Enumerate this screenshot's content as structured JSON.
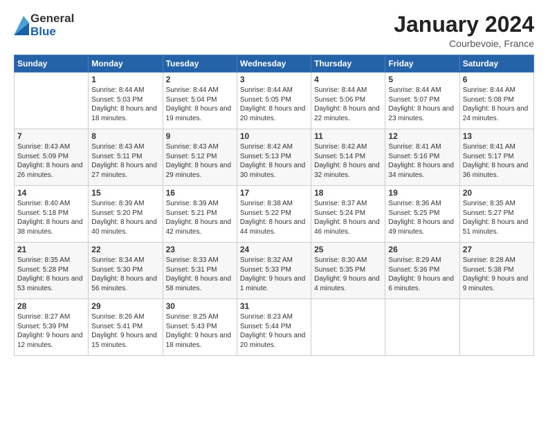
{
  "logo": {
    "general": "General",
    "blue": "Blue"
  },
  "title": "January 2024",
  "location": "Courbevoie, France",
  "days_of_week": [
    "Sunday",
    "Monday",
    "Tuesday",
    "Wednesday",
    "Thursday",
    "Friday",
    "Saturday"
  ],
  "weeks": [
    [
      {
        "day": "",
        "sunrise": "",
        "sunset": "",
        "daylight": ""
      },
      {
        "day": "1",
        "sunrise": "Sunrise: 8:44 AM",
        "sunset": "Sunset: 5:03 PM",
        "daylight": "Daylight: 8 hours and 18 minutes."
      },
      {
        "day": "2",
        "sunrise": "Sunrise: 8:44 AM",
        "sunset": "Sunset: 5:04 PM",
        "daylight": "Daylight: 8 hours and 19 minutes."
      },
      {
        "day": "3",
        "sunrise": "Sunrise: 8:44 AM",
        "sunset": "Sunset: 5:05 PM",
        "daylight": "Daylight: 8 hours and 20 minutes."
      },
      {
        "day": "4",
        "sunrise": "Sunrise: 8:44 AM",
        "sunset": "Sunset: 5:06 PM",
        "daylight": "Daylight: 8 hours and 22 minutes."
      },
      {
        "day": "5",
        "sunrise": "Sunrise: 8:44 AM",
        "sunset": "Sunset: 5:07 PM",
        "daylight": "Daylight: 8 hours and 23 minutes."
      },
      {
        "day": "6",
        "sunrise": "Sunrise: 8:44 AM",
        "sunset": "Sunset: 5:08 PM",
        "daylight": "Daylight: 8 hours and 24 minutes."
      }
    ],
    [
      {
        "day": "7",
        "sunrise": "Sunrise: 8:43 AM",
        "sunset": "Sunset: 5:09 PM",
        "daylight": "Daylight: 8 hours and 26 minutes."
      },
      {
        "day": "8",
        "sunrise": "Sunrise: 8:43 AM",
        "sunset": "Sunset: 5:11 PM",
        "daylight": "Daylight: 8 hours and 27 minutes."
      },
      {
        "day": "9",
        "sunrise": "Sunrise: 8:43 AM",
        "sunset": "Sunset: 5:12 PM",
        "daylight": "Daylight: 8 hours and 29 minutes."
      },
      {
        "day": "10",
        "sunrise": "Sunrise: 8:42 AM",
        "sunset": "Sunset: 5:13 PM",
        "daylight": "Daylight: 8 hours and 30 minutes."
      },
      {
        "day": "11",
        "sunrise": "Sunrise: 8:42 AM",
        "sunset": "Sunset: 5:14 PM",
        "daylight": "Daylight: 8 hours and 32 minutes."
      },
      {
        "day": "12",
        "sunrise": "Sunrise: 8:41 AM",
        "sunset": "Sunset: 5:16 PM",
        "daylight": "Daylight: 8 hours and 34 minutes."
      },
      {
        "day": "13",
        "sunrise": "Sunrise: 8:41 AM",
        "sunset": "Sunset: 5:17 PM",
        "daylight": "Daylight: 8 hours and 36 minutes."
      }
    ],
    [
      {
        "day": "14",
        "sunrise": "Sunrise: 8:40 AM",
        "sunset": "Sunset: 5:18 PM",
        "daylight": "Daylight: 8 hours and 38 minutes."
      },
      {
        "day": "15",
        "sunrise": "Sunrise: 8:39 AM",
        "sunset": "Sunset: 5:20 PM",
        "daylight": "Daylight: 8 hours and 40 minutes."
      },
      {
        "day": "16",
        "sunrise": "Sunrise: 8:39 AM",
        "sunset": "Sunset: 5:21 PM",
        "daylight": "Daylight: 8 hours and 42 minutes."
      },
      {
        "day": "17",
        "sunrise": "Sunrise: 8:38 AM",
        "sunset": "Sunset: 5:22 PM",
        "daylight": "Daylight: 8 hours and 44 minutes."
      },
      {
        "day": "18",
        "sunrise": "Sunrise: 8:37 AM",
        "sunset": "Sunset: 5:24 PM",
        "daylight": "Daylight: 8 hours and 46 minutes."
      },
      {
        "day": "19",
        "sunrise": "Sunrise: 8:36 AM",
        "sunset": "Sunset: 5:25 PM",
        "daylight": "Daylight: 8 hours and 49 minutes."
      },
      {
        "day": "20",
        "sunrise": "Sunrise: 8:35 AM",
        "sunset": "Sunset: 5:27 PM",
        "daylight": "Daylight: 8 hours and 51 minutes."
      }
    ],
    [
      {
        "day": "21",
        "sunrise": "Sunrise: 8:35 AM",
        "sunset": "Sunset: 5:28 PM",
        "daylight": "Daylight: 8 hours and 53 minutes."
      },
      {
        "day": "22",
        "sunrise": "Sunrise: 8:34 AM",
        "sunset": "Sunset: 5:30 PM",
        "daylight": "Daylight: 8 hours and 56 minutes."
      },
      {
        "day": "23",
        "sunrise": "Sunrise: 8:33 AM",
        "sunset": "Sunset: 5:31 PM",
        "daylight": "Daylight: 8 hours and 58 minutes."
      },
      {
        "day": "24",
        "sunrise": "Sunrise: 8:32 AM",
        "sunset": "Sunset: 5:33 PM",
        "daylight": "Daylight: 9 hours and 1 minute."
      },
      {
        "day": "25",
        "sunrise": "Sunrise: 8:30 AM",
        "sunset": "Sunset: 5:35 PM",
        "daylight": "Daylight: 9 hours and 4 minutes."
      },
      {
        "day": "26",
        "sunrise": "Sunrise: 8:29 AM",
        "sunset": "Sunset: 5:36 PM",
        "daylight": "Daylight: 9 hours and 6 minutes."
      },
      {
        "day": "27",
        "sunrise": "Sunrise: 8:28 AM",
        "sunset": "Sunset: 5:38 PM",
        "daylight": "Daylight: 9 hours and 9 minutes."
      }
    ],
    [
      {
        "day": "28",
        "sunrise": "Sunrise: 8:27 AM",
        "sunset": "Sunset: 5:39 PM",
        "daylight": "Daylight: 9 hours and 12 minutes."
      },
      {
        "day": "29",
        "sunrise": "Sunrise: 8:26 AM",
        "sunset": "Sunset: 5:41 PM",
        "daylight": "Daylight: 9 hours and 15 minutes."
      },
      {
        "day": "30",
        "sunrise": "Sunrise: 8:25 AM",
        "sunset": "Sunset: 5:43 PM",
        "daylight": "Daylight: 9 hours and 18 minutes."
      },
      {
        "day": "31",
        "sunrise": "Sunrise: 8:23 AM",
        "sunset": "Sunset: 5:44 PM",
        "daylight": "Daylight: 9 hours and 20 minutes."
      },
      {
        "day": "",
        "sunrise": "",
        "sunset": "",
        "daylight": ""
      },
      {
        "day": "",
        "sunrise": "",
        "sunset": "",
        "daylight": ""
      },
      {
        "day": "",
        "sunrise": "",
        "sunset": "",
        "daylight": ""
      }
    ]
  ]
}
